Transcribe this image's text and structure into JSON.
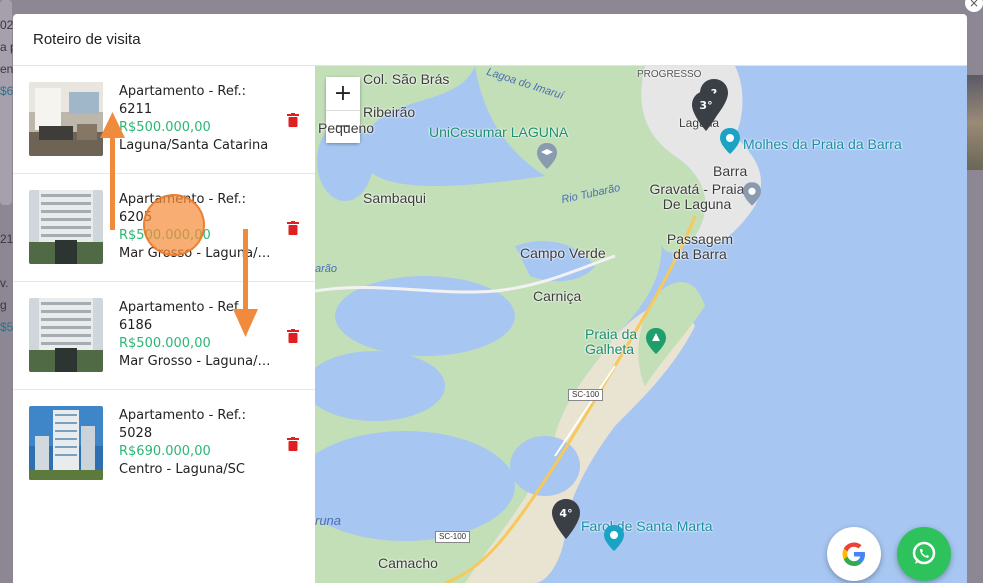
{
  "modal": {
    "title": "Roteiro de visita"
  },
  "background": {
    "snippets": [
      "02",
      "a p",
      "en",
      "$6",
      "21",
      "v.",
      "g",
      "$5"
    ]
  },
  "properties": [
    {
      "title": "Apartamento - Ref.: 6211",
      "price": "R$500.000,00",
      "location": "Laguna/Santa Catarina",
      "thumb_style": "interior"
    },
    {
      "title": "Apartamento - Ref.: 6205",
      "price": "R$500.000,00",
      "location": "Mar Grosso - Laguna/SC",
      "thumb_style": "tower"
    },
    {
      "title": "Apartamento - Ref.: 6186",
      "price": "R$500.000,00",
      "location": "Mar Grosso - Laguna/SC",
      "thumb_style": "tower"
    },
    {
      "title": "Apartamento - Ref.: 5028",
      "price": "R$690.000,00",
      "location": "Centro - Laguna/SC",
      "thumb_style": "tower-sky"
    }
  ],
  "icons": {
    "delete": "trash-icon",
    "pin": "map-pin-icon",
    "google": "google-icon",
    "whatsapp": "whatsapp-icon"
  },
  "map": {
    "zoom_in": "+",
    "zoom_out": "−",
    "labels": {
      "col_sao_bras": "Col. São Brás",
      "lagoa_imarui": "Lagoa do Imaruí",
      "progresso": "PROGRESSO",
      "ribeirao": "Ribeirão",
      "pequeno": "Pequeno",
      "unicesumar": "UniCesumar LAGUNA",
      "molhes": "Molhes da Praia da Barra",
      "barra": "Barra",
      "sambaqui": "Sambaqui",
      "rio_tubarao": "Rio Tubarão",
      "gravata": "Gravatá - Praia De Laguna",
      "passagem": "Passagem da Barra",
      "campo_verde": "Campo Verde",
      "carnica": "Carniça",
      "praia_galheta": "Praia da Galheta",
      "sc100_a": "SC-100",
      "sc100_b": "SC-100",
      "farol": "Farol de Santa Marta",
      "camacho": "Camacho",
      "laguna": "Laguna",
      "aguna": "runa",
      "tubarao_edge": "arão"
    },
    "markers": [
      "3°",
      "4°",
      "?"
    ],
    "colors": {
      "water": "#a7c6f1",
      "land": "#c3dfb8",
      "urban": "#e8e8e8",
      "marker": "#3a3e45"
    }
  },
  "tutorial": {
    "accent": "#f08a3c"
  }
}
